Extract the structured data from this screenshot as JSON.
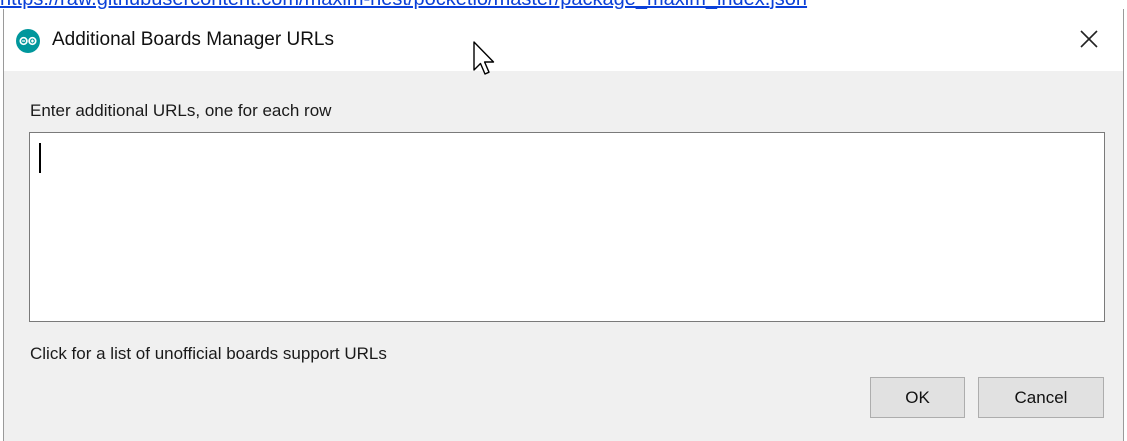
{
  "background_link": {
    "text": "https://raw.githubusercontent.com/maxim-nest/pocketio/master/package_maxim_index.json"
  },
  "dialog": {
    "title": "Additional Boards Manager URLs",
    "icon": "arduino-icon",
    "prompt": "Enter additional URLs, one for each row",
    "textarea_value": "",
    "unofficial_link": "Click for a list of unofficial boards support URLs",
    "buttons": {
      "ok": "OK",
      "cancel": "Cancel"
    }
  },
  "colors": {
    "accent_teal": "#00979c",
    "link_blue": "#0b40d8",
    "dialog_bg": "#f0f0f0"
  }
}
